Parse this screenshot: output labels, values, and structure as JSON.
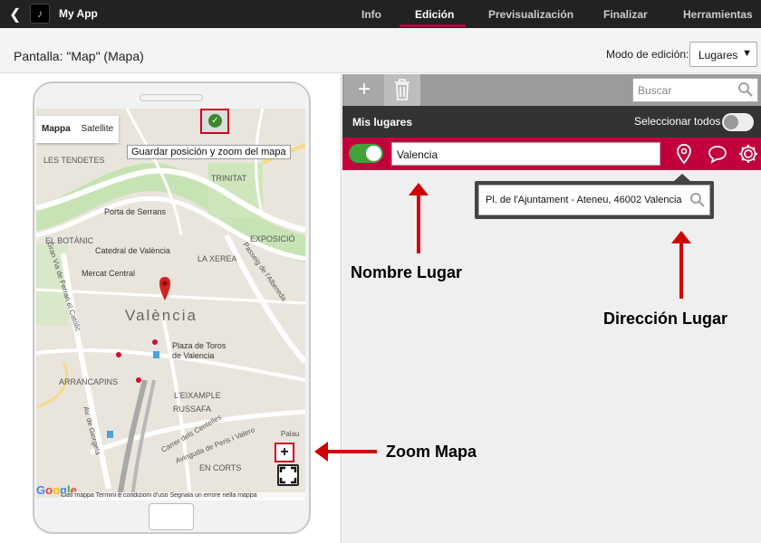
{
  "app": {
    "back_icon": "chevron-left-icon",
    "icon": "music-note-icon",
    "title": "My App"
  },
  "tabs": [
    {
      "label": "Info",
      "active": false
    },
    {
      "label": "Edición",
      "active": true
    },
    {
      "label": "Previsualización",
      "active": false
    },
    {
      "label": "Finalizar",
      "active": false
    },
    {
      "label": "Herramientas",
      "active": false
    }
  ],
  "screen": {
    "title": "Pantalla: \"Map\" (Mapa)"
  },
  "mode": {
    "label": "Modo de edición:",
    "selected": "Lugares"
  },
  "map": {
    "types": [
      "Mappa",
      "Satellite"
    ],
    "save_tooltip": "Guardar posición y zoom del mapa",
    "zoom_in": "+",
    "footer": "Dati mappa   Termini e condizioni d'uso   Segnala un errore nella mappa",
    "google": [
      "G",
      "o",
      "o",
      "g",
      "l",
      "e"
    ],
    "labels": {
      "les_tendetes": "LES TENDETES",
      "trinitat": "TRINITAT",
      "porta_serrans": "Porta de Serrans",
      "el_botanic": "EL BOTÀNIC",
      "catedral": "Catedral de València",
      "exposicio": "EXPOSICIÓ",
      "la_xerea": "LA XEREA",
      "mercat": "Mercat Central",
      "valencia": "València",
      "plaza_toros_1": "Plaza de Toros",
      "plaza_toros_2": "de Valencia",
      "arrancapins": "ARRANCAPINS",
      "eixample": "L'EIXAMPLE",
      "russafa": "RUSSAFA",
      "en_corts": "EN CORTS",
      "gran_via": "Gran Via de Ferran el Catòlic",
      "passeig": "Passeig de l'Albereda",
      "av_giorgeta": "Av. de Giorgeta",
      "carrer_centelles": "Carrer dels Centelles",
      "av_peris": "Avinguda de Peris i Valero",
      "palau": "Palau"
    }
  },
  "places": {
    "add_icon": "plus-icon",
    "delete_icon": "trash-icon",
    "search_placeholder": "Buscar",
    "header_label": "Mis lugares",
    "select_all": "Seleccionar todos",
    "place_name": "Valencia",
    "address": "Pl. de l'Ajuntament - Ateneu, 46002 Valencia",
    "accent": "#c2003c"
  },
  "annotations": {
    "name": "Nombre Lugar",
    "address": "Dirección Lugar",
    "zoom": "Zoom Mapa"
  }
}
